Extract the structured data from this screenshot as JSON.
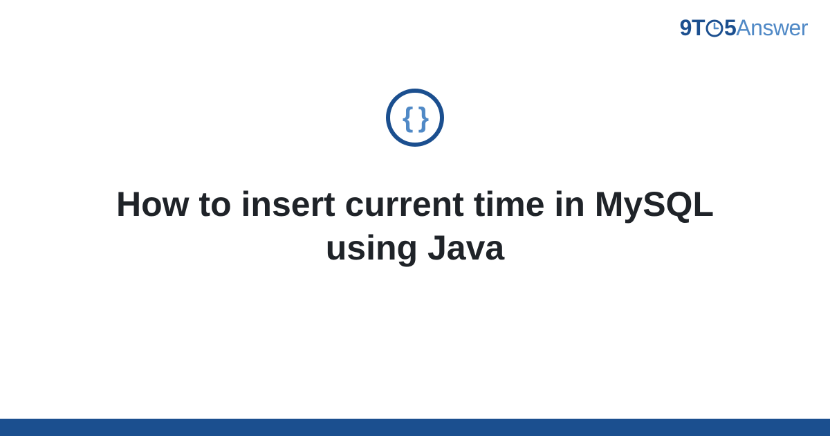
{
  "logo": {
    "prefix_nine": "9",
    "prefix_t": "T",
    "suffix_five": "5",
    "suffix_answer": "Answer"
  },
  "icon": {
    "braces": "{ }"
  },
  "main": {
    "title": "How to insert current time in MySQL using Java"
  },
  "colors": {
    "brand_dark": "#1b4f8f",
    "brand_light": "#5089c6",
    "text": "#1f2328"
  }
}
